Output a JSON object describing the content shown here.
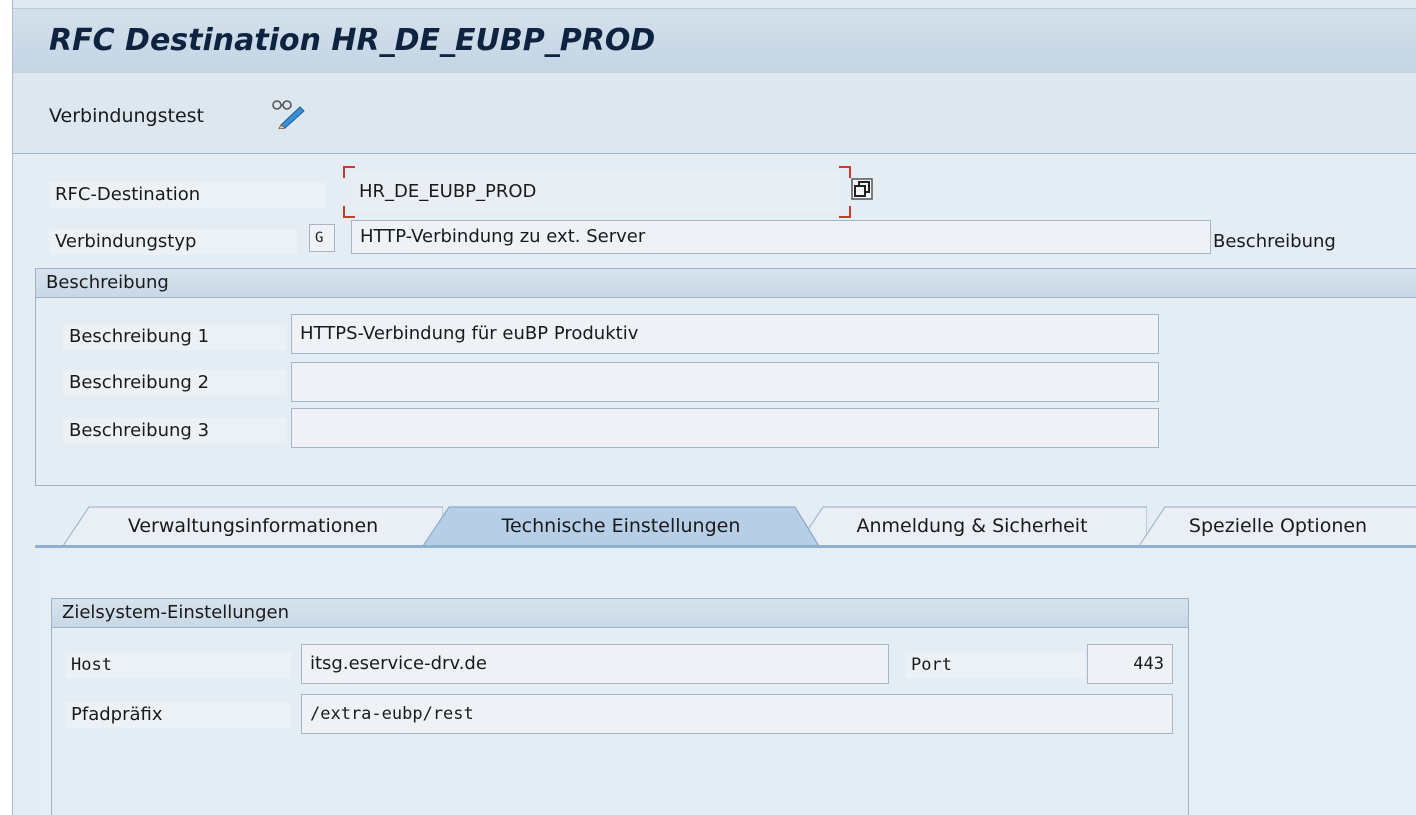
{
  "window": {
    "title": "RFC Destination HR_DE_EUBP_PROD"
  },
  "toolbar": {
    "connection_test_label": "Verbindungstest",
    "icon": "glasses-pencil-icon"
  },
  "header_fields": {
    "rfc_destination_label": "RFC-Destination",
    "rfc_destination_value": "HR_DE_EUBP_PROD",
    "connection_type_label": "Verbindungstyp",
    "connection_type_code": "G",
    "connection_type_value": "HTTP-Verbindung zu ext. Server",
    "description_side_label": "Beschreibung"
  },
  "description_group": {
    "title": "Beschreibung",
    "rows": [
      {
        "label": "Beschreibung 1",
        "value": "HTTPS-Verbindung für euBP Produktiv"
      },
      {
        "label": "Beschreibung 2",
        "value": ""
      },
      {
        "label": "Beschreibung 3",
        "value": ""
      }
    ]
  },
  "tabs": [
    {
      "label": "Verwaltungsinformationen",
      "active": false
    },
    {
      "label": "Technische Einstellungen",
      "active": true
    },
    {
      "label": "Anmeldung & Sicherheit",
      "active": false
    },
    {
      "label": "Spezielle Optionen",
      "active": false
    }
  ],
  "target_system_group": {
    "title": "Zielsystem-Einstellungen",
    "host_label": "Host",
    "host_value": "itsg.eservice-drv.de",
    "port_label": "Port",
    "port_value": "443",
    "path_prefix_label": "Pfadpräfix",
    "path_prefix_value": "/extra-eubp/rest"
  },
  "colors": {
    "title_text": "#0d2340",
    "focus_bracket": "#c83a2a",
    "active_tab": "#b6cfe6",
    "tab_line": "#8fb0cf"
  }
}
